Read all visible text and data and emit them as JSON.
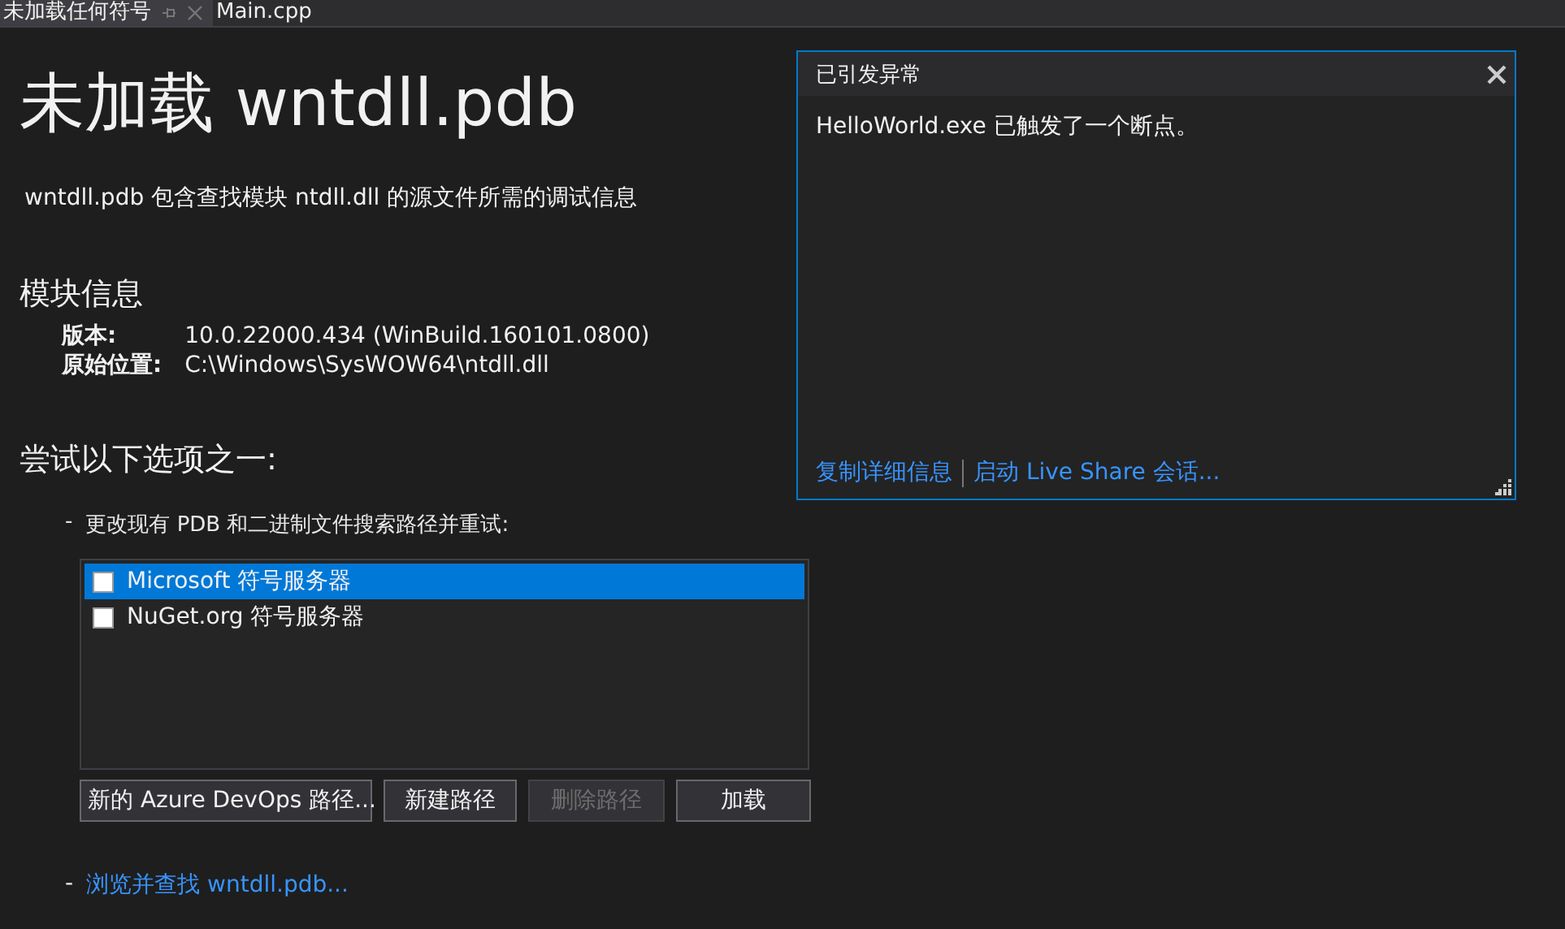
{
  "tabs": [
    {
      "label": "未加载任何符号",
      "selected": true,
      "pinnable": true
    },
    {
      "label": "Main.cpp",
      "selected": false,
      "pinnable": false
    }
  ],
  "title": "未加载 wntdll.pdb",
  "description": "wntdll.pdb 包含查找模块 ntdll.dll 的源文件所需的调试信息",
  "module_info": {
    "heading": "模块信息",
    "rows": [
      {
        "label": "版本:",
        "value": "10.0.22000.434 (WinBuild.160101.0800)"
      },
      {
        "label": "原始位置:",
        "value": "C:\\Windows\\SysWOW64\\ntdll.dll"
      }
    ]
  },
  "options": {
    "heading": "尝试以下选项之一:",
    "bullet": "-",
    "change_paths": "更改现有 PDB 和二进制文件搜索路径并重试:",
    "servers": [
      {
        "label": "Microsoft 符号服务器",
        "checked": false,
        "selected": true
      },
      {
        "label": "NuGet.org 符号服务器",
        "checked": false,
        "selected": false
      }
    ],
    "buttons": [
      {
        "label": "新的 Azure DevOps 路径...",
        "disabled": false
      },
      {
        "label": "新建路径",
        "disabled": false
      },
      {
        "label": "删除路径",
        "disabled": true
      },
      {
        "label": "加载",
        "disabled": false
      }
    ],
    "browse_bullet": "-",
    "browse_link": "浏览并查找 wntdll.pdb..."
  },
  "exception_popup": {
    "title": "已引发异常",
    "message": "HelloWorld.exe 已触发了一个断点。",
    "links": [
      "复制详细信息",
      "启动 Live Share 会话..."
    ]
  }
}
